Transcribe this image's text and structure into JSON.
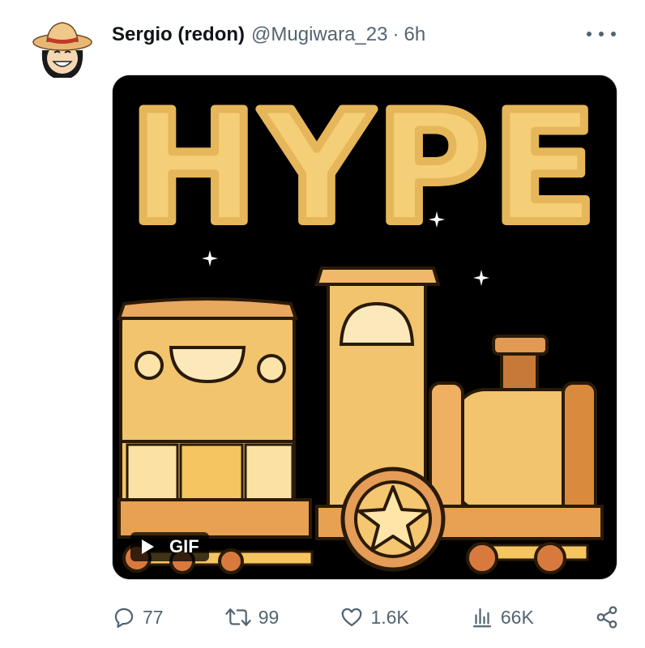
{
  "tweet": {
    "author_name": "Sergio (redon)",
    "handle": "@Mugiwara_23",
    "separator": "·",
    "time": "6h",
    "media": {
      "headline": "HYPE",
      "badge": "GIF"
    },
    "actions": {
      "replies": "77",
      "retweets": "99",
      "likes": "1.6K",
      "views": "66K"
    }
  },
  "colors": {
    "accent_text": "#536471",
    "media_bg": "#000000",
    "cloud_text": "#F4CF78",
    "train_body": "#F2C46E"
  },
  "icons": [
    "more-icon",
    "play-icon",
    "reply-icon",
    "retweet-icon",
    "like-icon",
    "views-icon",
    "share-icon"
  ]
}
